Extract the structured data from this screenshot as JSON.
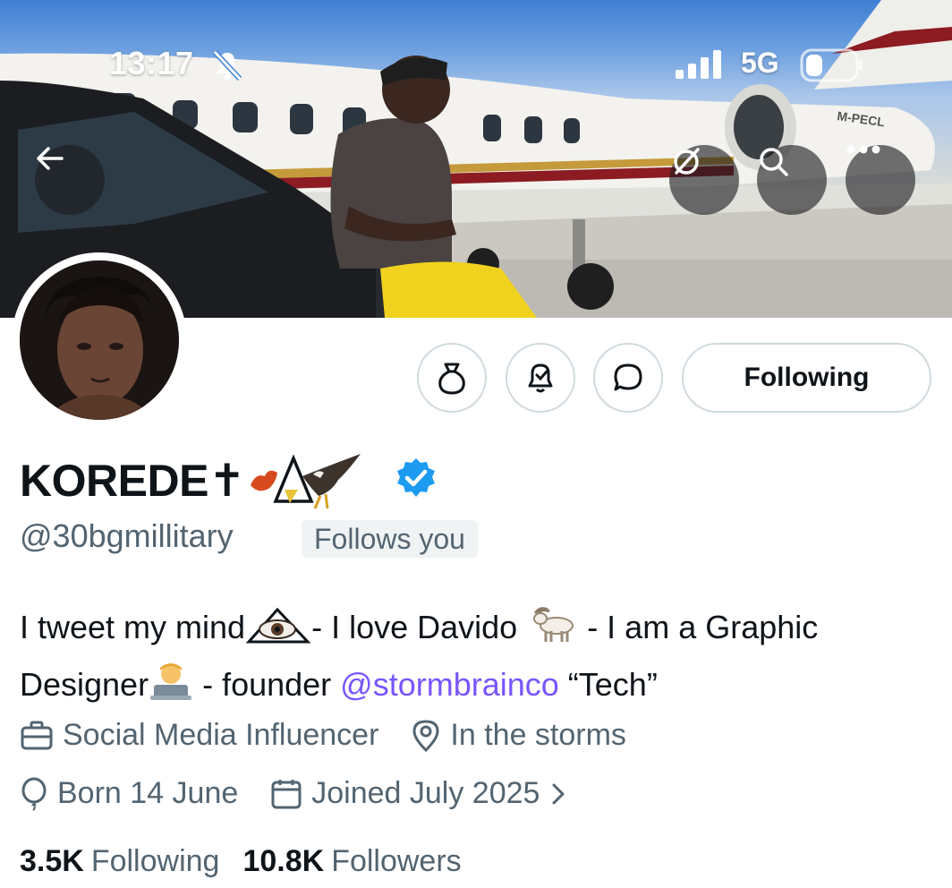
{
  "status_bar": {
    "time": "13:17",
    "network": "5G",
    "icons": [
      "bell-muted-icon",
      "signal-bars-icon",
      "battery-icon"
    ]
  },
  "header_buttons": {
    "icons": [
      "back-arrow-icon",
      "grok-icon",
      "search-icon",
      "more-icon"
    ]
  },
  "profile": {
    "display_name": "KOREDE✝",
    "verified": true,
    "handle": "@30bgmillitary",
    "follows_you": "Follows you",
    "bio": {
      "part1": "I tweet my mind",
      "part2": "- I love Davido ",
      "part3": " - I am a Graphic Designer",
      "part4": " - founder ",
      "mention": "@stormbrainco",
      "part5": " “Tech”"
    },
    "category": "Social Media Influencer",
    "location": "In the storms",
    "birthday": "Born 14 June",
    "joined": "Joined July 2025",
    "following_count": "3.5K",
    "following_label": "Following",
    "followers_count": "10.8K",
    "followers_label": "Followers"
  },
  "actions": {
    "following_button": "Following",
    "icons": [
      "tip-jar-icon",
      "notification-bell-icon",
      "message-bubble-icon"
    ]
  },
  "colors": {
    "accent": "#1d9bf0",
    "mention": "#7856ff",
    "secondary_text": "#536471",
    "border": "#cfd9de"
  }
}
